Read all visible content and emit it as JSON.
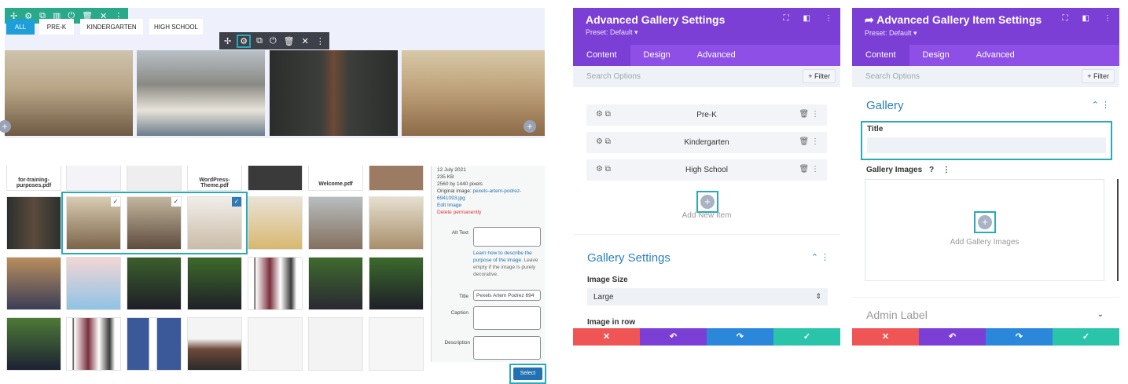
{
  "preview": {
    "filters": [
      "ALL",
      "PRE-K",
      "KINDERGARTEN",
      "HIGH SCHOOL"
    ],
    "section_toolbar_icons": [
      "move-icon",
      "gear-icon",
      "duplicate-icon",
      "columns-icon",
      "power-icon",
      "trash-icon",
      "close-icon",
      "more-icon"
    ],
    "module_toolbar_icons": [
      "move-icon",
      "gear-icon",
      "duplicate-icon",
      "power-icon",
      "trash-icon",
      "close-icon",
      "more-icon"
    ]
  },
  "media": {
    "files": [
      "for-training-purposes.pdf",
      "WordPress-Theme.pdf",
      "Welcome.pdf"
    ],
    "details": {
      "date": "12 July 2021",
      "size": "235 KB",
      "dimensions": "2560 by 1440 pixels",
      "original_label": "Original image:",
      "original_file": "pexels-artem-podrez-6941093.jpg",
      "edit": "Edit Image",
      "delete": "Delete permanently"
    },
    "fields": {
      "alt_text": "Alt Text",
      "alt_help_link": "Learn how to describe the purpose of the image",
      "alt_help_rest": ". Leave empty if the image is purely decorative.",
      "title": "Title",
      "title_value": "Pexels Artem Podrez 694",
      "caption": "Caption",
      "description": "Description"
    },
    "select_button": "Select"
  },
  "panel1": {
    "title": "Advanced Gallery Settings",
    "preset": "Preset: Default ▾",
    "tabs": [
      "Content",
      "Design",
      "Advanced"
    ],
    "search_placeholder": "Search Options",
    "filter": "+ Filter",
    "items": [
      "Pre-K",
      "Kindergarten",
      "High School"
    ],
    "add_new": "Add New Item",
    "section": "Gallery Settings",
    "image_size_label": "Image Size",
    "image_size_value": "Large",
    "image_in_row_label": "Image in row"
  },
  "panel2": {
    "title": "Advanced Gallery Item Settings",
    "preset": "Preset: Default ▾",
    "tabs": [
      "Content",
      "Design",
      "Advanced"
    ],
    "search_placeholder": "Search Options",
    "filter": "+ Filter",
    "section": "Gallery",
    "title_label": "Title",
    "gallery_images_label": "Gallery Images",
    "add_images": "Add Gallery Images",
    "admin_label": "Admin Label"
  },
  "colors": {
    "purple": "#7b3fd6",
    "teal": "#2aa98a",
    "highlight": "#2aa9b8",
    "red": "#ef5555",
    "blue": "#2b87da",
    "green": "#29c4a9"
  }
}
